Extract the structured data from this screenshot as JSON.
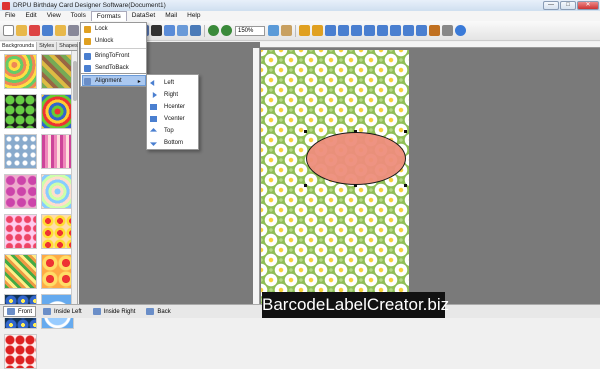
{
  "window": {
    "title": "DRPU Birthday Card Designer Software(Document1)",
    "minimize": "—",
    "maximize": "□",
    "close": "✕"
  },
  "menu": [
    "File",
    "Edit",
    "View",
    "Tools",
    "Formats",
    "DataSet",
    "Mail",
    "Help"
  ],
  "toolbar": {
    "zoom": "150%"
  },
  "left_panel": {
    "tabs": [
      "Backgrounds",
      "Styles",
      "Shapes",
      "I"
    ]
  },
  "formats_menu": {
    "items": [
      "Lock",
      "Unlock",
      "BringToFront",
      "SendToBack"
    ],
    "alignment": "Alignment"
  },
  "alignment_submenu": [
    "Left",
    "Right",
    "Hcenter",
    "Vcenter",
    "Top",
    "Bottom"
  ],
  "statusbar": [
    "Front",
    "Inside Left",
    "Inside Right",
    "Back"
  ],
  "brand": "BarcodeLabelCreator.biz",
  "colors": {
    "accent": "#aac8f0",
    "card_bg": "#8fbf55",
    "ellipse": "#ee8e7c"
  }
}
